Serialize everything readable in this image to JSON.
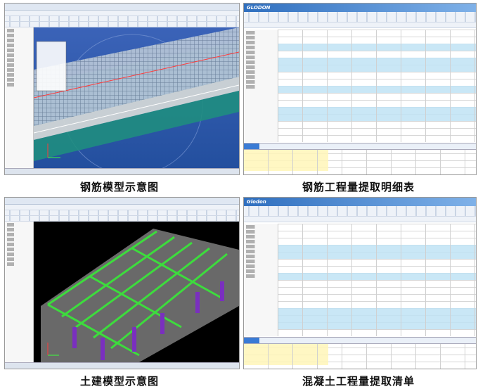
{
  "panels": [
    {
      "caption": "钢筋模型示意图"
    },
    {
      "caption": "钢筋工程量提取明细表",
      "logo": "GLODON"
    },
    {
      "caption": "土建模型示意图"
    },
    {
      "caption": "混凝土工程量提取清单",
      "logo": "Glodon"
    }
  ],
  "colors": {
    "rebar_bg": "#2a58aa",
    "steel_green": "#3ddc3d",
    "column_purple": "#7a2fbf",
    "table_highlight": "#bfe3f5"
  }
}
